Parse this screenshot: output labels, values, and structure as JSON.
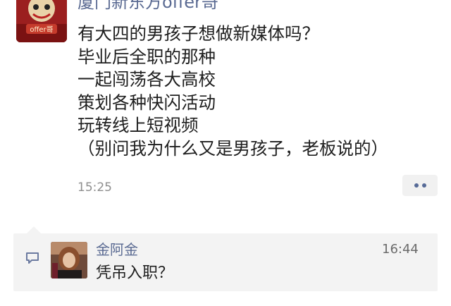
{
  "post": {
    "author": "厦门新东方offer哥",
    "avatar_icon": "lion-dance-avatar-icon",
    "avatar_badge": "offer哥",
    "body_lines": [
      "有大四的男孩子想做新媒体吗？",
      "毕业后全职的那种",
      "一起闯荡各大高校",
      "策划各种快闪活动",
      "玩转线上短视频",
      "（别问我为什么又是男孩子，老板说的）"
    ],
    "time": "15:25",
    "more_icon": "more-dots-icon"
  },
  "comment": {
    "icon": "comment-bubble-icon",
    "avatar_icon": "user-avatar-icon",
    "author": "金阿金",
    "time": "16:44",
    "text": "凭吊入职？"
  },
  "colors": {
    "link_blue": "#5a6a92",
    "comment_bg": "#f3f3f3",
    "time_gray": "#8e8e8e"
  }
}
